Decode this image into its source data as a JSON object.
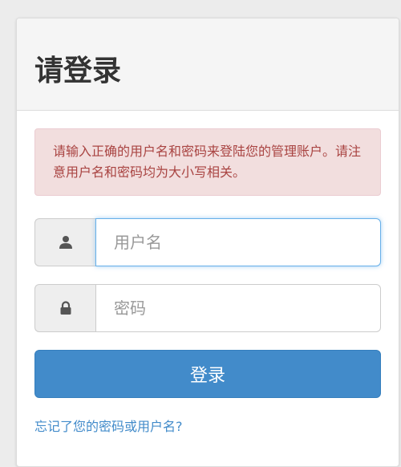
{
  "title": "请登录",
  "alert": {
    "message": "请输入正确的用户名和密码来登陆您的管理账户。请注意用户名和密码均为大小写相关。"
  },
  "username": {
    "icon": "user-icon",
    "placeholder": "用户名",
    "value": ""
  },
  "password": {
    "icon": "lock-icon",
    "placeholder": "密码",
    "value": ""
  },
  "login_button": {
    "label": "登录"
  },
  "forgot_link": {
    "label": "忘记了您的密码或用户名?"
  },
  "colors": {
    "primary": "#428bca",
    "alert_bg": "#f2dede",
    "alert_text": "#a94442",
    "link": "#428bca"
  }
}
